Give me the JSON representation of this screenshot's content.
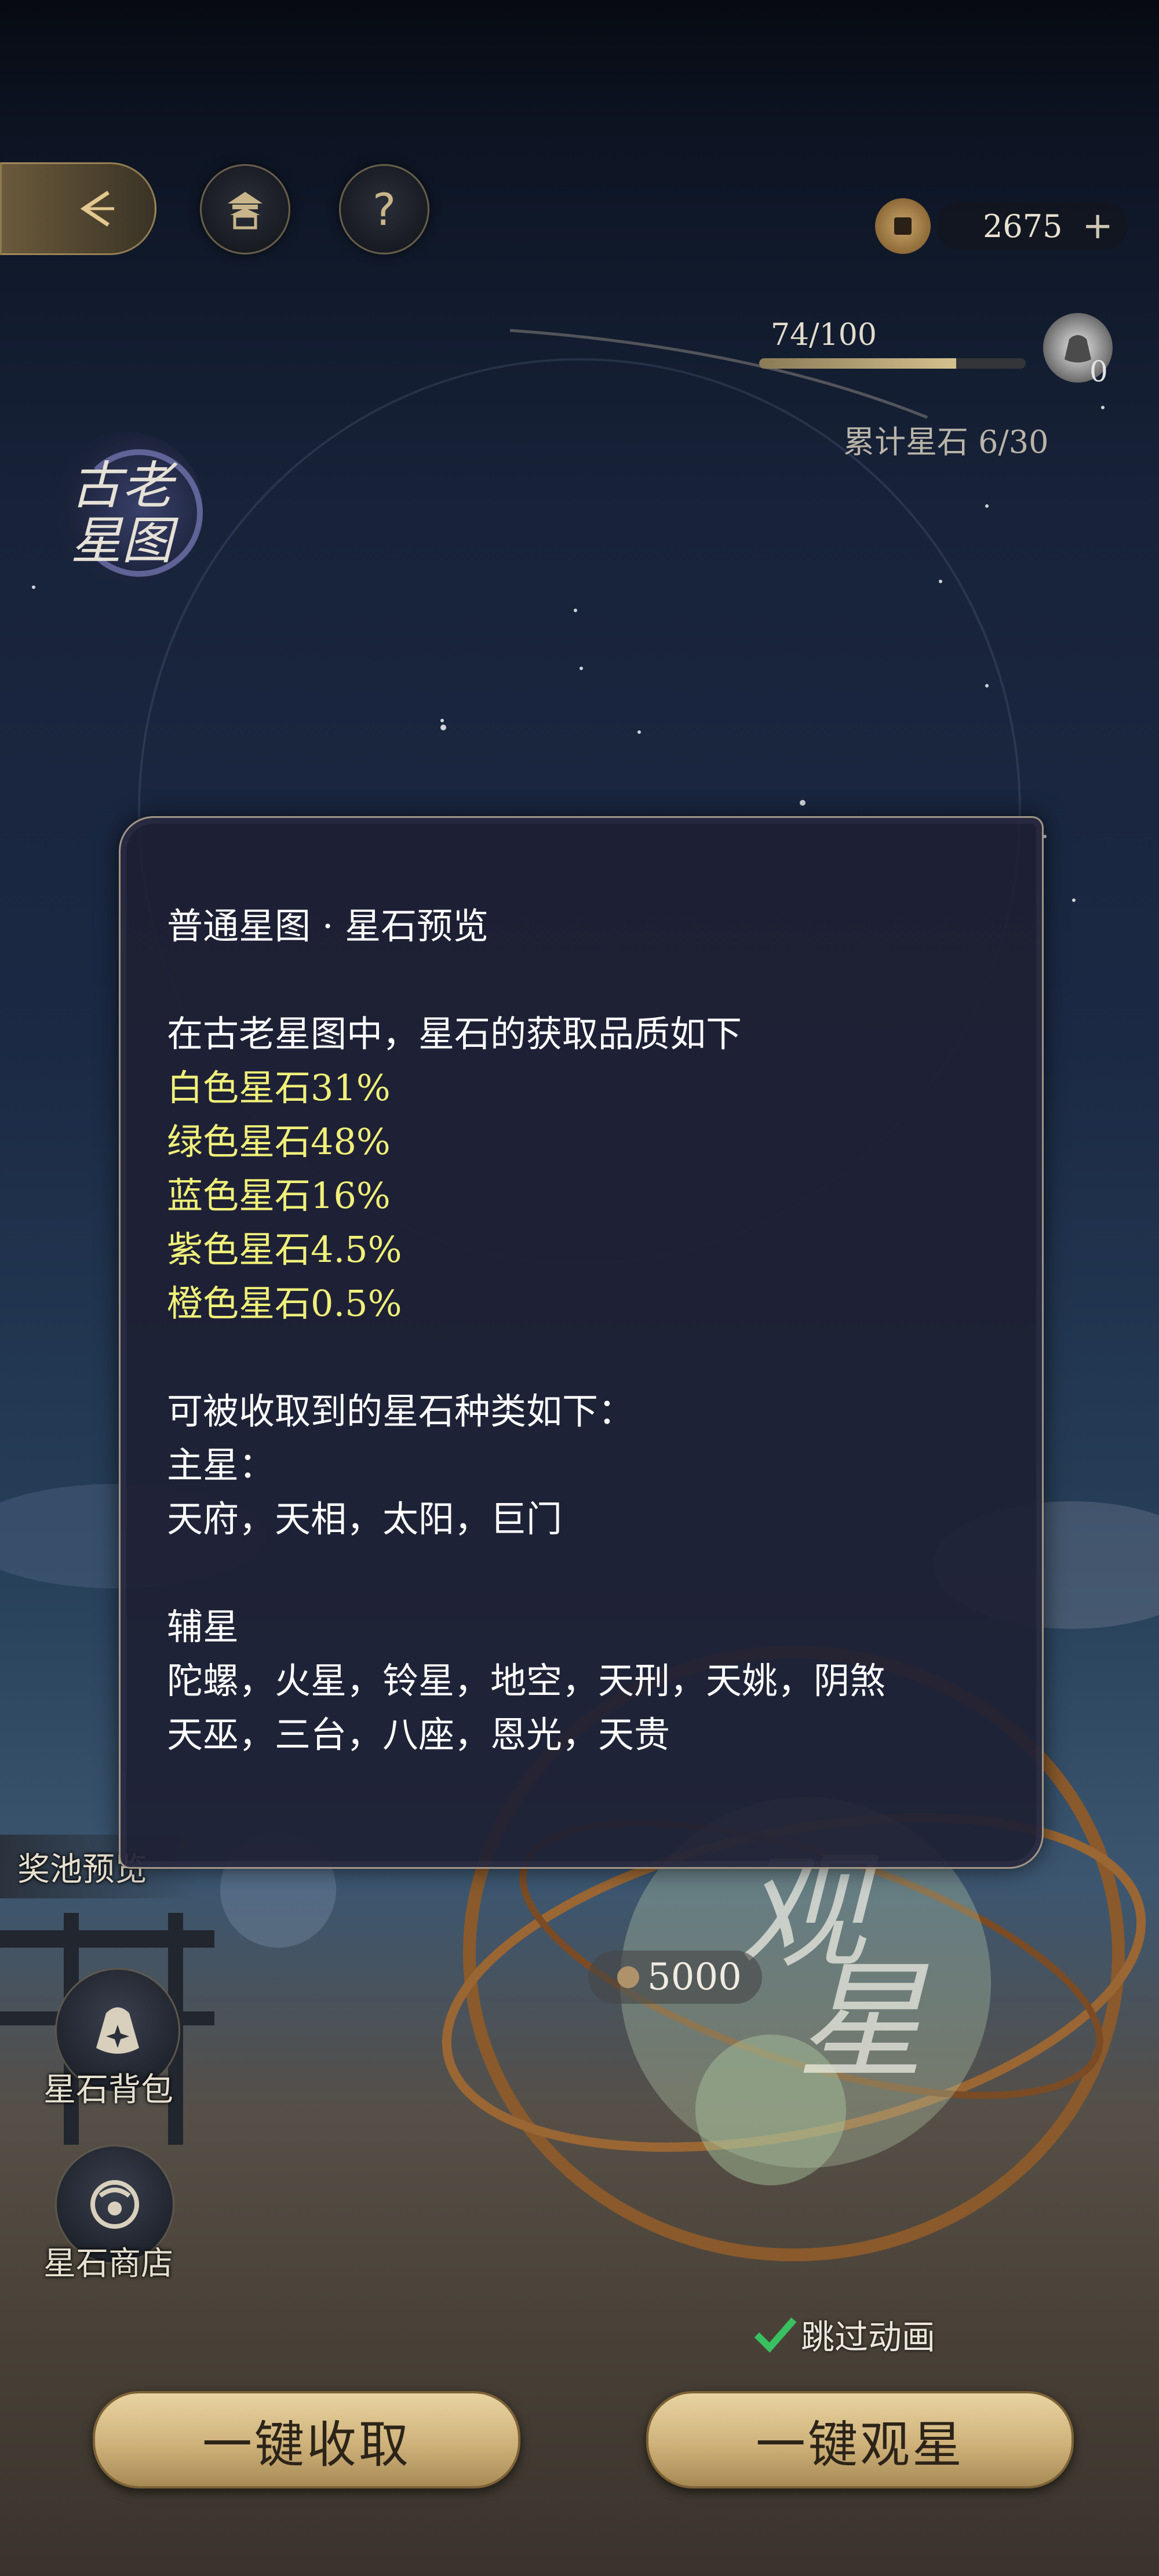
{
  "topbar": {
    "back_icon": "back-arrow-icon",
    "palace_icon": "pavilion-icon",
    "help_label": "?",
    "currency_icon": "copper-coin-icon",
    "currency_amount": "2675",
    "add_label": "+"
  },
  "progress": {
    "text": "74/100",
    "value": 0.74,
    "bag_count": "0",
    "cumulative_label": "累计星石 6/30"
  },
  "logo": {
    "text": "古老星图"
  },
  "preview_panel": {
    "title": "普通星图 · 星石预览",
    "intro": "在古老星图中，星石的获取品质如下",
    "qualities": [
      "白色星石31%",
      "绿色星石48%",
      "蓝色星石16%",
      "紫色星石4.5%",
      "橙色星石0.5%"
    ],
    "kinds_heading": "可被收取到的星石种类如下：",
    "main_heading": "主星：",
    "main_stars": "天府，天相，太阳，巨门",
    "aux_heading": "辅星",
    "aux_line1": "陀螺，火星，铃星，地空，天刑，天姚，阴煞",
    "aux_line2": "天巫，三台，八座，恩光，天贵"
  },
  "side": {
    "pool_preview": "奖池预览",
    "backpack_label": "星石背包",
    "shop_label": "星石商店"
  },
  "observe": {
    "cost": "5000",
    "big_text_1": "观",
    "big_text_2": "星"
  },
  "skip_animation": {
    "label": "跳过动画",
    "checked": true
  },
  "buttons": {
    "collect_all": "一键收取",
    "observe_all": "一键观星"
  },
  "colors": {
    "highlight": "#f0f07a",
    "gold": "#cfb27a",
    "panel_bg": "#1e2034"
  }
}
